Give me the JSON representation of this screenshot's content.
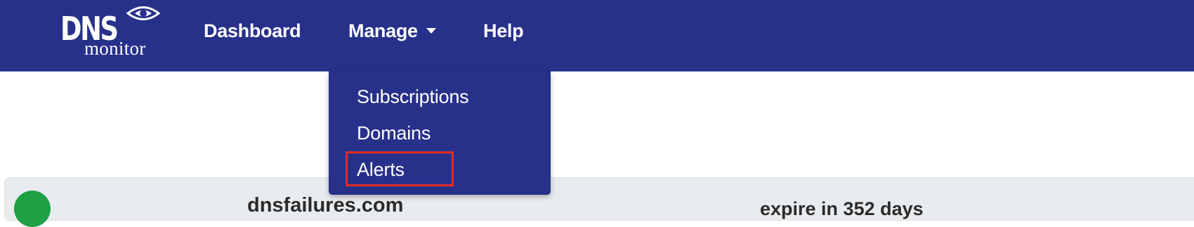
{
  "brand": {
    "logo_top": "DNS",
    "logo_bottom": "monitor"
  },
  "nav": {
    "dashboard_label": "Dashboard",
    "manage_label": "Manage",
    "help_label": "Help"
  },
  "manage_menu": {
    "items": [
      {
        "label": "Subscriptions"
      },
      {
        "label": "Domains"
      },
      {
        "label": "Alerts",
        "highlighted": true
      }
    ]
  },
  "domain_card": {
    "domain": "dnsfailures.com",
    "expiry_text": "expire in 352 days",
    "status_color": "#1fa045"
  },
  "colors": {
    "navbar": "#27318a",
    "highlight": "#e32b22",
    "card_bg": "#e9ecef"
  }
}
